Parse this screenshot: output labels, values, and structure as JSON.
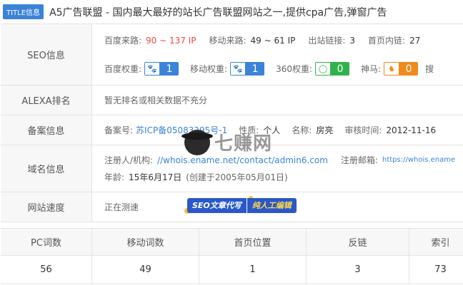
{
  "title": {
    "badge": "TITLE信息",
    "text": "A5广告联盟 - 国内最大最好的站长广告联盟网站之一,提供cpa广告,弹窗广告"
  },
  "seo": {
    "label": "SEO信息",
    "baidu_traffic_label": "百度来路:",
    "baidu_traffic_value": "90 ~ 137 IP",
    "mobile_traffic_label": "移动来路:",
    "mobile_traffic_value": "49 ~ 61 IP",
    "outbound_label": "出站链接:",
    "outbound_value": "3",
    "home_links_label": "首页内链:",
    "home_links_value": "27",
    "baidu_weight_label": "百度权重:",
    "baidu_weight_value": "1",
    "mobile_weight_label": "移动权重:",
    "mobile_weight_value": "1",
    "weight360_label": "360权重:",
    "weight360_value": "0",
    "shenma_label": "神马:",
    "shenma_value": "0",
    "cut_label": "搜"
  },
  "alexa": {
    "label": "ALEXA排名",
    "value": "暂无排名或相关数据不充分"
  },
  "beian": {
    "label": "备案信息",
    "number_label": "备案号:",
    "number_value": "苏ICP备05083295号-1",
    "nature_label": "性质:",
    "nature_value": "个人",
    "name_label": "名称:",
    "name_value": "房亮",
    "audit_label": "审核时间:",
    "audit_value": "2012-11-16"
  },
  "domain": {
    "label": "域名信息",
    "registrar_label": "注册人/机构:",
    "registrar_value": "//whois.ename.net/contact/admin6.com",
    "email_label": "注册邮箱:",
    "email_value": "https://whois.ename",
    "age_label": "年龄:",
    "age_value": "15年6月17日",
    "created_value": "(创建于2005年05月01日)"
  },
  "speed": {
    "label": "网站速度",
    "value": "正在测速"
  },
  "promo": {
    "left": "SEO文章代写",
    "right": "纯人工编辑"
  },
  "watermark": {
    "text": "七赚网"
  },
  "stats": {
    "headers": [
      "PC词数",
      "移动词数",
      "首页位置",
      "反链",
      "索引"
    ],
    "values": [
      "56",
      "49",
      "1",
      "3",
      "73"
    ]
  },
  "colors": {
    "accent_blue": "#3b83d8",
    "traffic_red": "#e94a3f",
    "green": "#2fb24b",
    "orange": "#f08a1c"
  }
}
